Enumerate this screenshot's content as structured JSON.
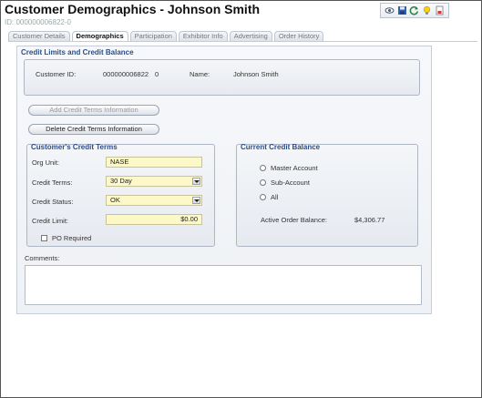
{
  "header": {
    "title": "Customer Demographics - Johnson Smith",
    "id_label": "ID: 000000006822-0",
    "toolbar_icons": [
      "view-icon",
      "save-icon",
      "refresh-icon",
      "lightbulb-icon",
      "report-icon"
    ]
  },
  "tabs": [
    {
      "label": "Customer Details"
    },
    {
      "label": "Demographics"
    },
    {
      "label": "Participation"
    },
    {
      "label": "Exhibitor Info"
    },
    {
      "label": "Advertising"
    },
    {
      "label": "Order History"
    }
  ],
  "credit": {
    "section_title": "Credit Limits and Credit Balance",
    "customer_id_label": "Customer ID:",
    "customer_id_value": "000000006822",
    "customer_id_suffix": "0",
    "name_label": "Name:",
    "name_value": "Johnson Smith",
    "add_button": "Add Credit Terms Information",
    "delete_button": "Delete Credit Terms Information"
  },
  "terms": {
    "title": "Customer's Credit Terms",
    "org_unit_label": "Org Unit:",
    "org_unit_value": "NASE",
    "credit_terms_label": "Credit Terms:",
    "credit_terms_value": "30 Day",
    "credit_status_label": "Credit Status:",
    "credit_status_value": "OK",
    "credit_limit_label": "Credit Limit:",
    "credit_limit_value": "$0.00",
    "po_required_label": "PO Required"
  },
  "balance": {
    "title": "Current Credit Balance",
    "master_label": "Master Account",
    "sub_label": "Sub-Account",
    "all_label": "All",
    "active_order_label": "Active Order Balance:",
    "active_order_value": "$4,306.77"
  },
  "comments": {
    "label": "Comments:"
  }
}
